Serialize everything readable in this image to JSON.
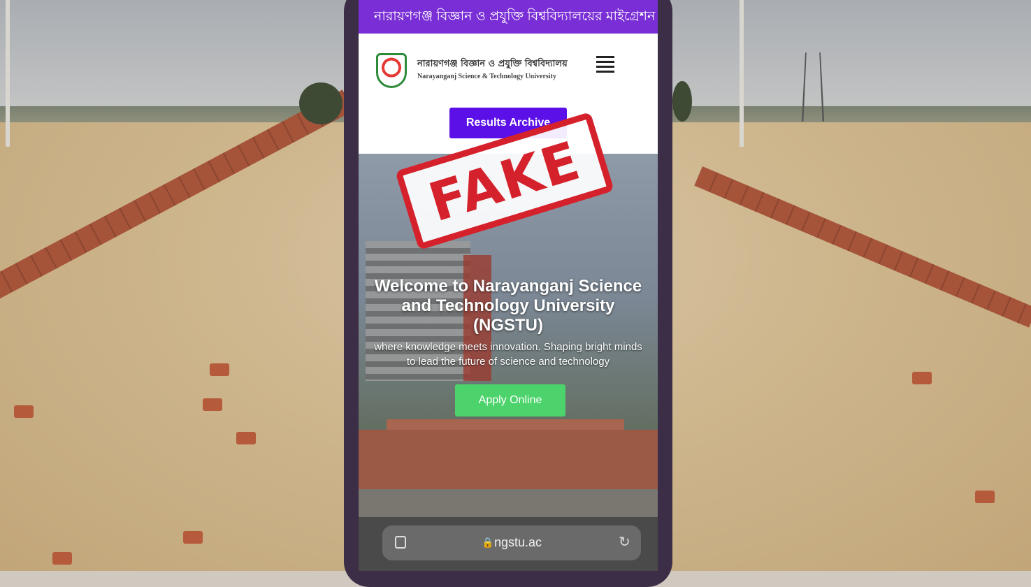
{
  "banner": {
    "marquee_text": "নারায়ণগঞ্জ বিজ্ঞান ও প্রযুক্তি বিশ্ববিদ্যালয়ের মাইগ্রেশন সংক্রান্ত"
  },
  "header": {
    "name_bn": "নারায়ণগঞ্জ বিজ্ঞান ও প্রযুক্তি বিশ্ববিদ্যালয়",
    "name_en": "Narayanganj Science & Technology University",
    "logo_icon": "university-crest-icon",
    "menu_icon": "hamburger-menu-icon"
  },
  "nav": {
    "results_archive_label": "Results Archive"
  },
  "hero": {
    "title": "Welcome to Narayanganj Science and Technology University (NGSTU)",
    "subtitle": "where knowledge meets innovation. Shaping bright minds to lead the future of science and technology",
    "apply_label": "Apply Online"
  },
  "browser": {
    "url": "ngstu.ac",
    "tabs_icon": "tabs-icon",
    "lock_icon": "lock-icon",
    "reload_icon": "reload-icon"
  },
  "stamp": {
    "text": "FAKE",
    "color": "#d4212b"
  },
  "colors": {
    "banner_bg": "#7a2ed6",
    "results_button_bg": "#5b10e8",
    "apply_button_bg": "#4cd36b"
  }
}
